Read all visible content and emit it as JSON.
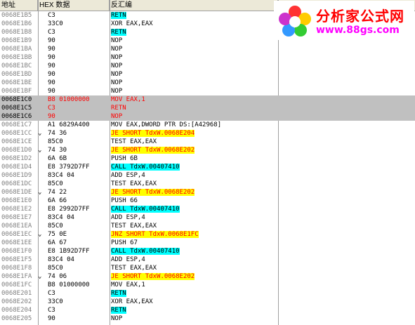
{
  "headers": {
    "address": "地址",
    "hex": "HEX 数据",
    "disasm": "反汇编"
  },
  "logo": {
    "title": "分析家公式网",
    "url": "www.88gs.com"
  },
  "rows": [
    {
      "addr": "0068E1B5",
      "hex": "C3",
      "disasm": "RETN",
      "hl": "cyan"
    },
    {
      "addr": "0068E1B6",
      "hex": "33C0",
      "disasm": "XOR EAX,EAX"
    },
    {
      "addr": "0068E1B8",
      "hex": "C3",
      "disasm": "RETN",
      "hl": "cyan"
    },
    {
      "addr": "0068E1B9",
      "hex": "90",
      "disasm": "NOP"
    },
    {
      "addr": "0068E1BA",
      "hex": "90",
      "disasm": "NOP"
    },
    {
      "addr": "0068E1BB",
      "hex": "90",
      "disasm": "NOP"
    },
    {
      "addr": "0068E1BC",
      "hex": "90",
      "disasm": "NOP"
    },
    {
      "addr": "0068E1BD",
      "hex": "90",
      "disasm": "NOP"
    },
    {
      "addr": "0068E1BE",
      "hex": "90",
      "disasm": "NOP"
    },
    {
      "addr": "0068E1BF",
      "hex": "90",
      "disasm": "NOP"
    },
    {
      "addr": "0068E1C0",
      "hex": "B8 01000000",
      "disasm": "MOV EAX,1",
      "sel": true
    },
    {
      "addr": "0068E1C5",
      "hex": "C3",
      "disasm": "RETN",
      "sel": true
    },
    {
      "addr": "0068E1C6",
      "hex": "90",
      "disasm": "NOP",
      "sel": true
    },
    {
      "addr": "0068E1C7",
      "hex": "A1 6829A400",
      "disasm": "MOV EAX,DWORD PTR DS:[A42968]"
    },
    {
      "addr": "0068E1CC",
      "hex": "74 36",
      "disasm": "JE SHORT TdxW.0068E204",
      "hl": "yellow",
      "arrow": "v"
    },
    {
      "addr": "0068E1CE",
      "hex": "85C0",
      "disasm": "TEST EAX,EAX"
    },
    {
      "addr": "0068E1D0",
      "hex": "74 30",
      "disasm": "JE SHORT TdxW.0068E202",
      "hl": "yellow",
      "arrow": "v"
    },
    {
      "addr": "0068E1D2",
      "hex": "6A 6B",
      "disasm": "PUSH 6B"
    },
    {
      "addr": "0068E1D4",
      "hex": "E8 3792D7FF",
      "disasm": "CALL TdxW.00407410",
      "hl": "cyan"
    },
    {
      "addr": "0068E1D9",
      "hex": "83C4 04",
      "disasm": "ADD ESP,4"
    },
    {
      "addr": "0068E1DC",
      "hex": "85C0",
      "disasm": "TEST EAX,EAX"
    },
    {
      "addr": "0068E1DE",
      "hex": "74 22",
      "disasm": "JE SHORT TdxW.0068E202",
      "hl": "yellow",
      "arrow": "v"
    },
    {
      "addr": "0068E1E0",
      "hex": "6A 66",
      "disasm": "PUSH 66"
    },
    {
      "addr": "0068E1E2",
      "hex": "E8 2992D7FF",
      "disasm": "CALL TdxW.00407410",
      "hl": "cyan"
    },
    {
      "addr": "0068E1E7",
      "hex": "83C4 04",
      "disasm": "ADD ESP,4"
    },
    {
      "addr": "0068E1EA",
      "hex": "85C0",
      "disasm": "TEST EAX,EAX"
    },
    {
      "addr": "0068E1EC",
      "hex": "75 0E",
      "disasm": "JNZ SHORT TdxW.0068E1FC",
      "hl": "yellow",
      "arrow": "v"
    },
    {
      "addr": "0068E1EE",
      "hex": "6A 67",
      "disasm": "PUSH 67"
    },
    {
      "addr": "0068E1F0",
      "hex": "E8 1B92D7FF",
      "disasm": "CALL TdxW.00407410",
      "hl": "cyan"
    },
    {
      "addr": "0068E1F5",
      "hex": "83C4 04",
      "disasm": "ADD ESP,4"
    },
    {
      "addr": "0068E1F8",
      "hex": "85C0",
      "disasm": "TEST EAX,EAX"
    },
    {
      "addr": "0068E1FA",
      "hex": "74 06",
      "disasm": "JE SHORT TdxW.0068E202",
      "hl": "yellow",
      "arrow": "v"
    },
    {
      "addr": "0068E1FC",
      "hex": "B8 01000000",
      "disasm": "MOV EAX,1"
    },
    {
      "addr": "0068E201",
      "hex": "C3",
      "disasm": "RETN",
      "hl": "cyan"
    },
    {
      "addr": "0068E202",
      "hex": "33C0",
      "disasm": "XOR EAX,EAX"
    },
    {
      "addr": "0068E204",
      "hex": "C3",
      "disasm": "RETN",
      "hl": "cyan"
    },
    {
      "addr": "0068E205",
      "hex": "90",
      "disasm": "NOP"
    }
  ]
}
